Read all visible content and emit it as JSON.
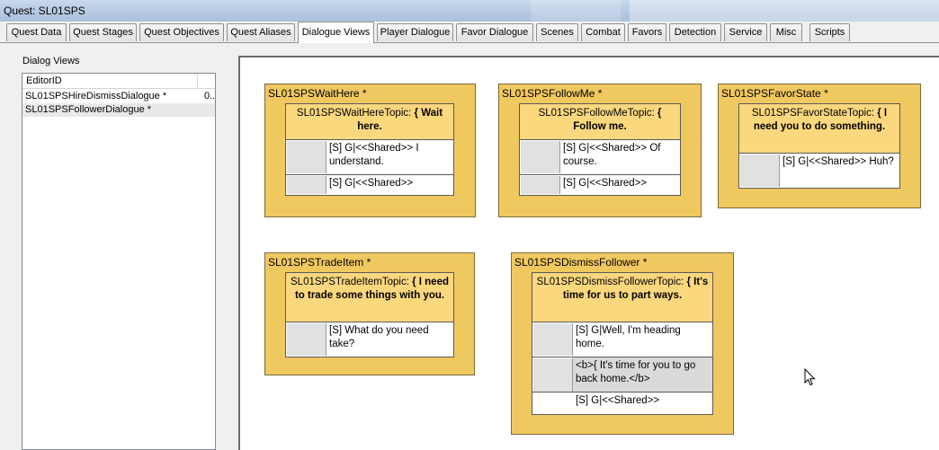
{
  "window": {
    "title": "Quest: SL01SPS"
  },
  "tabs": [
    {
      "label": "Quest Data"
    },
    {
      "label": "Quest Stages"
    },
    {
      "label": "Quest Objectives"
    },
    {
      "label": "Quest Aliases"
    },
    {
      "label": "Dialogue Views",
      "active": true
    },
    {
      "label": "Player Dialogue"
    },
    {
      "label": "Favor Dialogue"
    },
    {
      "label": "Scenes"
    },
    {
      "label": "Combat"
    },
    {
      "label": "Favors"
    },
    {
      "label": "Detection"
    },
    {
      "label": "Service"
    },
    {
      "label": "Misc"
    },
    {
      "label": "Scripts"
    }
  ],
  "dialog_views": {
    "label": "Dialog Views",
    "column_header": "EditorID",
    "rows": [
      {
        "id": "SL01SPSHireDismissDialogue *",
        "extra": "0..."
      },
      {
        "id": "SL01SPSFollowerDialogue *",
        "extra": "",
        "selected": true
      }
    ]
  },
  "branches": [
    {
      "title": "SL01SPSWaitHere *",
      "topic_name": "SL01SPSWaitHereTopic:",
      "topic_text": "{ Wait here.",
      "responses": [
        {
          "text": "[S] G|<<Shared>> I understand."
        },
        {
          "text": "[S] G|<<Shared>>"
        }
      ]
    },
    {
      "title": "SL01SPSFollowMe *",
      "topic_name": "SL01SPSFollowMeTopic:",
      "topic_text": "{ Follow me.",
      "responses": [
        {
          "text": "[S] G|<<Shared>> Of course."
        },
        {
          "text": "[S] G|<<Shared>>"
        }
      ]
    },
    {
      "title": "SL01SPSFavorState *",
      "topic_name": "SL01SPSFavorStateTopic:",
      "topic_text": "{ I need you to do something.",
      "responses": [
        {
          "text": "[S] G|<<Shared>> Huh?"
        }
      ]
    },
    {
      "title": "SL01SPSTradeItem *",
      "topic_name": "SL01SPSTradeItemTopic:",
      "topic_text": "{ I need to trade some things with you.",
      "responses": [
        {
          "text": "[S] What do you need take?"
        }
      ]
    },
    {
      "title": "SL01SPSDismissFollower *",
      "topic_name": "SL01SPSDismissFollowerTopic:",
      "topic_text": "{ It's time for us to part ways.",
      "responses": [
        {
          "text": "[S] G|Well, I'm heading home."
        },
        {
          "text": "<b>{ It's time for you to go back home.</b>",
          "shaded": true
        },
        {
          "text": "[S] G|<<Shared>>"
        }
      ]
    }
  ],
  "colors": {
    "branch_fill": "#f0c860",
    "topic_fill": "#fbd77e",
    "canvas": "#ffffff",
    "titlebar": "#b6c9e2"
  }
}
